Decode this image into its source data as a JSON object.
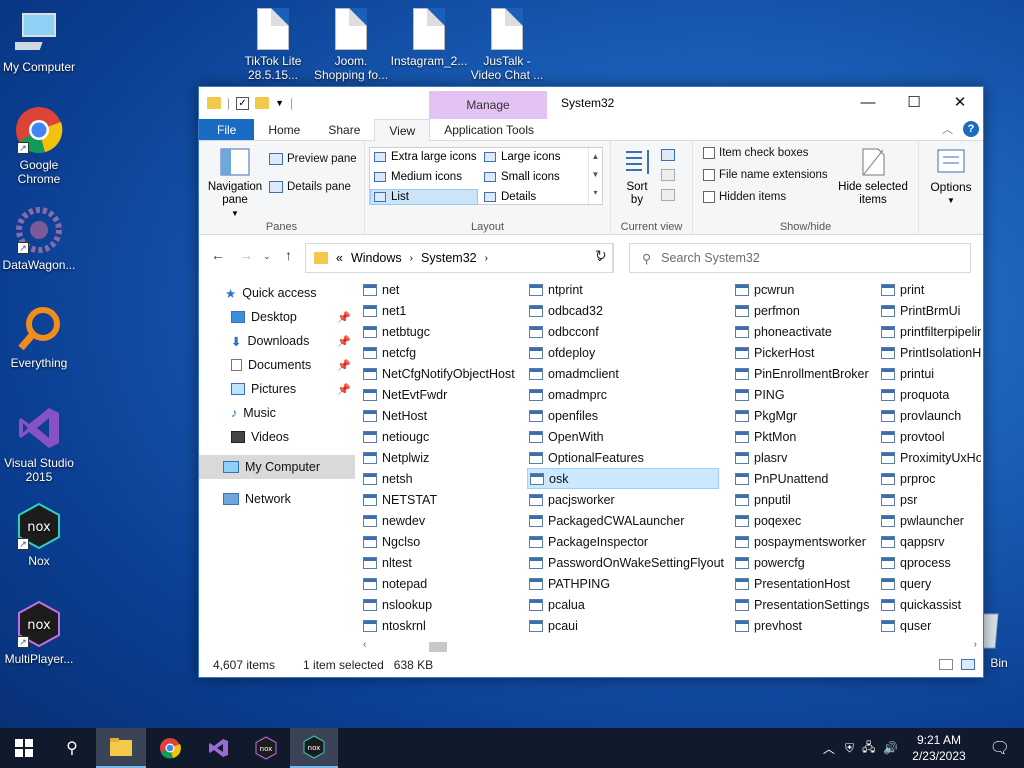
{
  "desktop": {
    "left_icons": [
      {
        "label": "My Computer"
      },
      {
        "label": "Google Chrome"
      },
      {
        "label": "DataWagon..."
      },
      {
        "label": "Everything"
      },
      {
        "label": "Visual Studio 2015"
      },
      {
        "label": "Nox"
      },
      {
        "label": "MultiPlayer..."
      }
    ],
    "top_icons": [
      {
        "label": "TikTok Lite 28.5.15..."
      },
      {
        "label": "Joom. Shopping fo..."
      },
      {
        "label": "Instagram_2..."
      },
      {
        "label": "JusTalk - Video Chat ..."
      }
    ],
    "recycle_bin": "Bin"
  },
  "window": {
    "title": "System32",
    "context_tab": "Manage",
    "tabs": [
      "File",
      "Home",
      "Share",
      "View",
      "Application Tools"
    ],
    "active_tab": "View",
    "ribbon": {
      "panes": {
        "navigation": "Navigation pane",
        "preview": "Preview pane",
        "details": "Details pane",
        "label": "Panes"
      },
      "layout": {
        "items": [
          "Extra large icons",
          "Large icons",
          "Medium icons",
          "Small icons",
          "List",
          "Details"
        ],
        "selected": "List",
        "label": "Layout"
      },
      "current_view": {
        "sort": "Sort by",
        "label": "Current view"
      },
      "show_hide": {
        "item_check_boxes": "Item check boxes",
        "file_name_extensions": "File name extensions",
        "hidden_items": "Hidden items",
        "hide_selected": "Hide selected items",
        "label": "Show/hide"
      },
      "options": "Options"
    },
    "address": {
      "crumbs": [
        "Windows",
        "System32"
      ],
      "prefix": "«"
    },
    "search": {
      "placeholder": "Search System32"
    },
    "nav": [
      {
        "label": "Quick access",
        "pinned": false
      },
      {
        "label": "Desktop",
        "pinned": true
      },
      {
        "label": "Downloads",
        "pinned": true
      },
      {
        "label": "Documents",
        "pinned": true
      },
      {
        "label": "Pictures",
        "pinned": true
      },
      {
        "label": "Music",
        "pinned": false
      },
      {
        "label": "Videos",
        "pinned": false
      },
      {
        "label": "My Computer",
        "pinned": false
      },
      {
        "label": "Network",
        "pinned": false
      }
    ],
    "columns": [
      [
        "net",
        "net1",
        "netbtugc",
        "netcfg",
        "NetCfgNotifyObjectHost",
        "NetEvtFwdr",
        "NetHost",
        "netiougc",
        "Netplwiz",
        "netsh",
        "NETSTAT",
        "newdev",
        "Ngclso",
        "nltest",
        "notepad",
        "nslookup",
        "ntoskrnl"
      ],
      [
        "ntprint",
        "odbcad32",
        "odbcconf",
        "ofdeploy",
        "omadmclient",
        "omadmprc",
        "openfiles",
        "OpenWith",
        "OptionalFeatures",
        "osk",
        "pacjsworker",
        "PackagedCWALauncher",
        "PackageInspector",
        "PasswordOnWakeSettingFlyout",
        "PATHPING",
        "pcalua",
        "pcaui"
      ],
      [
        "pcwrun",
        "perfmon",
        "phoneactivate",
        "PickerHost",
        "PinEnrollmentBroker",
        "PING",
        "PkgMgr",
        "PktMon",
        "plasrv",
        "PnPUnattend",
        "pnputil",
        "poqexec",
        "pospaymentsworker",
        "powercfg",
        "PresentationHost",
        "PresentationSettings",
        "prevhost"
      ],
      [
        "print",
        "PrintBrmUi",
        "printfilterpipelin",
        "PrintIsolationHo",
        "printui",
        "proquota",
        "provlaunch",
        "provtool",
        "ProximityUxHos",
        "prproc",
        "psr",
        "pwlauncher",
        "qappsrv",
        "qprocess",
        "query",
        "quickassist",
        "quser"
      ]
    ],
    "selected_file": "osk",
    "status": {
      "count": "4,607 items",
      "selection": "1 item selected",
      "size": "638 KB"
    }
  },
  "taskbar": {
    "time": "9:21 AM",
    "date": "2/23/2023"
  }
}
